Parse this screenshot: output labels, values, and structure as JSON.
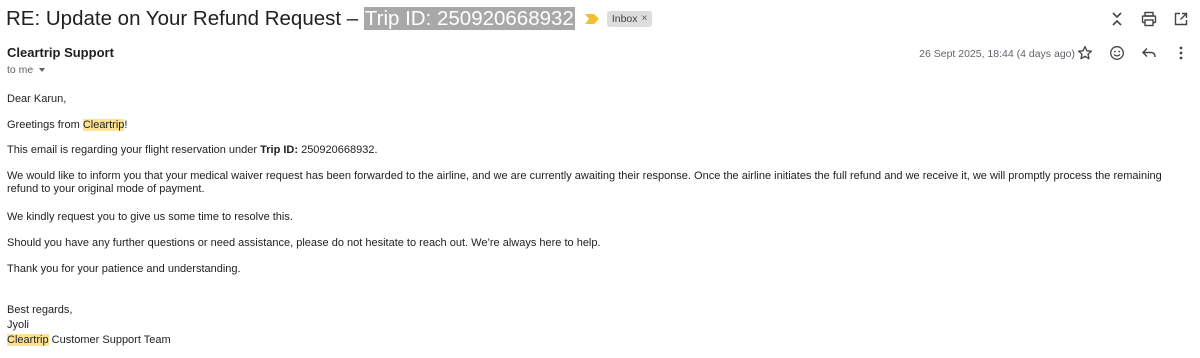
{
  "email": {
    "subject_prefix": "RE: Update on Your Refund Request – ",
    "subject_selected": "Trip ID: 250920668932",
    "label": "Inbox",
    "label_remove": "×",
    "sender": "Cleartrip Support",
    "recipient": "to me",
    "date": "26 Sept 2025, 18:44 (4 days ago)"
  },
  "icons": {
    "importance": "importance-marker-icon",
    "collapse": "unfold-less-icon",
    "print": "print-icon",
    "open_new": "open-in-new-window-icon",
    "star": "star-icon",
    "emoji": "emoji-reaction-icon",
    "reply": "reply-icon",
    "more": "more-vertical-icon"
  },
  "colors": {
    "highlight": "#fde293",
    "selection": "#a8a8a8",
    "importance": "#f2c02e",
    "chip": "#dddddd"
  },
  "body": {
    "greeting": "Dear Karun,",
    "greetings_pre": "Greetings from ",
    "brand": "Cleartrip",
    "greetings_post": "!",
    "regarding_pre": "This email is regarding your flight reservation under ",
    "regarding_bold": "Trip ID:",
    "regarding_post": " 250920668932.",
    "inform": "We would like to inform you that your medical waiver request has been forwarded to the airline, and we are currently awaiting their response. Once the airline initiates the full refund and we receive it, we will promptly process the remaining refund to your original mode of payment.",
    "request_time": "We kindly request you to give us some time to resolve this.",
    "questions": "Should you have any further questions or need assistance, please do not hesitate to reach out. We’re always here to help.",
    "thanks": "Thank you for your patience and understanding.",
    "regards": "Best regards,",
    "signer": "Jyoli",
    "sig_brand": "Cleartrip",
    "sig_team": " Customer Support Team"
  }
}
